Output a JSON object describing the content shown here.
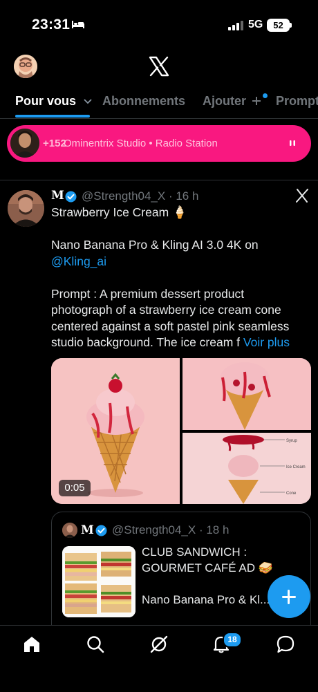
{
  "status_bar": {
    "time": "23:31",
    "network": "5G",
    "battery": "52"
  },
  "header": {
    "tabs": [
      {
        "label": "Pour vous",
        "active": true
      },
      {
        "label": "Abonnements",
        "active": false
      },
      {
        "label": "Ajouter",
        "active": false
      },
      {
        "label": "Prompt",
        "active": false
      }
    ]
  },
  "live": {
    "count": "+152",
    "title": "Ominentrix Studio • Radio Station",
    "color": "#f91880"
  },
  "tweet": {
    "name": "M",
    "handle_meta": "@Strength04_X · 16 h",
    "line1": "Strawberry Ice Cream 🍦",
    "line2": "Nano Banana Pro & Kling AI 3.0 4K on",
    "mention": "@Kling_ai",
    "prompt": "Prompt : A premium dessert product photograph of a strawberry ice cream cone centered against a soft pastel pink seamless studio background. The ice cream f",
    "more": "Voir plus",
    "video_duration": "0:05",
    "diagram_labels": [
      "Syrup",
      "Ice Cream",
      "Cone"
    ]
  },
  "quote": {
    "name": "M",
    "handle_meta": "@Strength04_X · 18 h",
    "line1": "CLUB SANDWICH :",
    "line2": "GOURMET CAFÉ AD 🥪",
    "line3": "Nano Banana Pro & Kl..."
  },
  "nav": {
    "notifications_badge": "18"
  },
  "colors": {
    "accent": "#1d9bf0",
    "live": "#f91880"
  }
}
